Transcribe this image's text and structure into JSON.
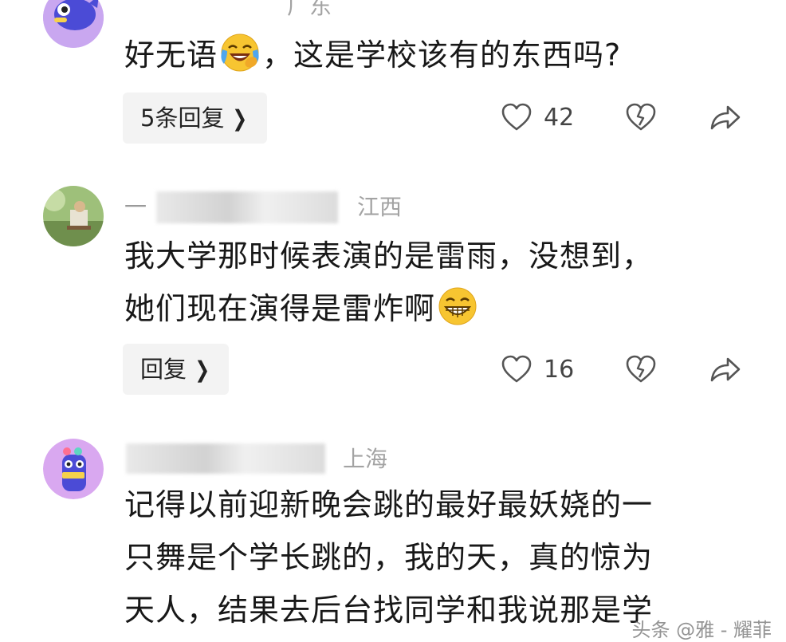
{
  "comments": [
    {
      "location": "广东",
      "text_before_emoji": "好无语",
      "emoji": "crying-laughing-emoji",
      "text_after_emoji": "，这是学校该有的东西吗?",
      "reply_label": "5条回复",
      "likes": "42"
    },
    {
      "username_visible": "一",
      "location": "江西",
      "line1": "我大学那时候表演的是雷雨，没想到，",
      "line2_before_emoji": "她们现在演得是雷炸啊",
      "emoji": "grinning-emoji",
      "reply_label": "回复",
      "likes": "16"
    },
    {
      "location": "上海",
      "line1": "记得以前迎新晚会跳的最好最妖娆的一",
      "line2": "只舞是个学长跳的，我的天，真的惊为",
      "line3": "天人，结果去后台找同学和我说那是学"
    }
  ],
  "icons": {
    "like": "heart-outline-icon",
    "dislike": "broken-heart-icon",
    "share": "share-arrow-icon",
    "reply_chevron": "chevron-right-icon"
  },
  "watermark": "头条 @雅 - 耀菲"
}
